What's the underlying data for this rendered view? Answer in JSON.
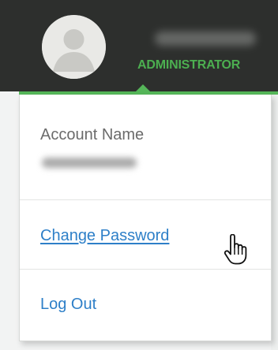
{
  "header": {
    "role": "ADMINISTRATOR",
    "avatar_icon": "user-avatar-icon",
    "accent_color": "#55b659"
  },
  "dropdown": {
    "account_label": "Account Name",
    "change_password_label": "Change Password",
    "logout_label": "Log Out",
    "link_color": "#2d7fc8"
  },
  "cursor": {
    "icon": "hand-pointer-icon"
  }
}
